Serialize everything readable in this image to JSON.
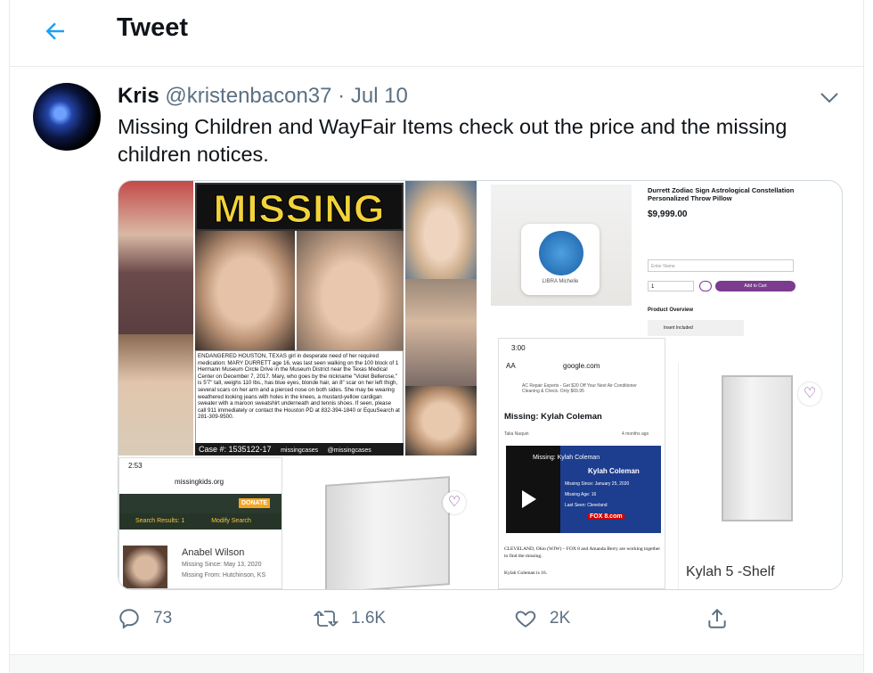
{
  "header": {
    "title": "Tweet"
  },
  "tweet": {
    "author_name": "Kris",
    "handle": "@kristenbacon37",
    "separator": "·",
    "date": "Jul 10",
    "text": "Missing Children and WayFair Items check out the price and the missing children notices."
  },
  "media": {
    "missing_banner": "MISSING",
    "notice_text": "ENDANGERED HOUSTON, TEXAS girl in desperate need of her required medication: MARY DURRETT age 16, was last seen walking on the 100 block of 1 Hermann Museum Circle Drive in the Museum District near the Texas Medical Center on December 7, 2017. Mary, who goes by the nickname \"Violet Bellerose,\" is 5'7\" tall, weighs 110 lbs., has blue eyes, blonde hair, an 8\" scar on her left thigh, several scars on her arm and a pierced nose on both sides. She may be wearing weathered looking jeans with holes in the knees, a mustard-yellow cardigan sweater with a maroon sweatshirt underneath and tennis shoes. If seen, please call 911 immediately or contact the Houston PD at 832-394-1840 or EquuSearch at 281-309-9500.",
    "case_bar": "Case #: 1535122-17",
    "case_social_1": "missingcases",
    "case_social_2": "@missingcases",
    "phone1": {
      "time": "2:53",
      "url": "missingkids.org",
      "donate": "DONATE",
      "results": "Search Results: 1",
      "modify": "Modify Search",
      "child_name": "Anabel Wilson",
      "since": "Missing Since: May 13, 2020",
      "from": "Missing From: Hutchinson, KS"
    },
    "product": {
      "title": "Durrett Zodiac Sign Astrological Constellation Personalized Throw Pillow",
      "price": "$9,999.00",
      "personalize_placeholder": "Enter Name",
      "qty": "1",
      "add_to_cart": "Add to Cart",
      "overview": "Product Overview",
      "insert": "Insert Included",
      "pillow_text": "LIBRA Michelle"
    },
    "phone2": {
      "time": "3:00",
      "aa": "AA",
      "url": "google.com",
      "ad": "AC Repair Experts - Get $20 Off Your Next Air Conditioner Cleaning & Check. Only $69.95",
      "headline": "Missing: Kylah Coleman",
      "byline": "Talia Naquin",
      "ago": "4 months ago",
      "video_title": "Missing: Kylah Coleman",
      "video_name": "Kylah Coleman",
      "since_label": "Missing Since:",
      "since_val": "January 25, 2020",
      "age_label": "Missing Age:",
      "age_val": "16",
      "seen_label": "Last Seen:",
      "seen_val": "Cleveland",
      "station": "FOX 8.com",
      "body1": "CLEVELAND, Ohio (WJW) – FOX 8 and Amanda Berry are working together to find the missing.",
      "body2": "Kylah Coleman is 16."
    },
    "cabinet_caption": "Kylah 5 -Shelf"
  },
  "actions": {
    "replies": "73",
    "retweets": "1.6K",
    "likes": "2K"
  },
  "colors": {
    "accent": "#1da1f2",
    "muted": "#5b7083",
    "wayfair_purple": "#7b3b8f"
  }
}
